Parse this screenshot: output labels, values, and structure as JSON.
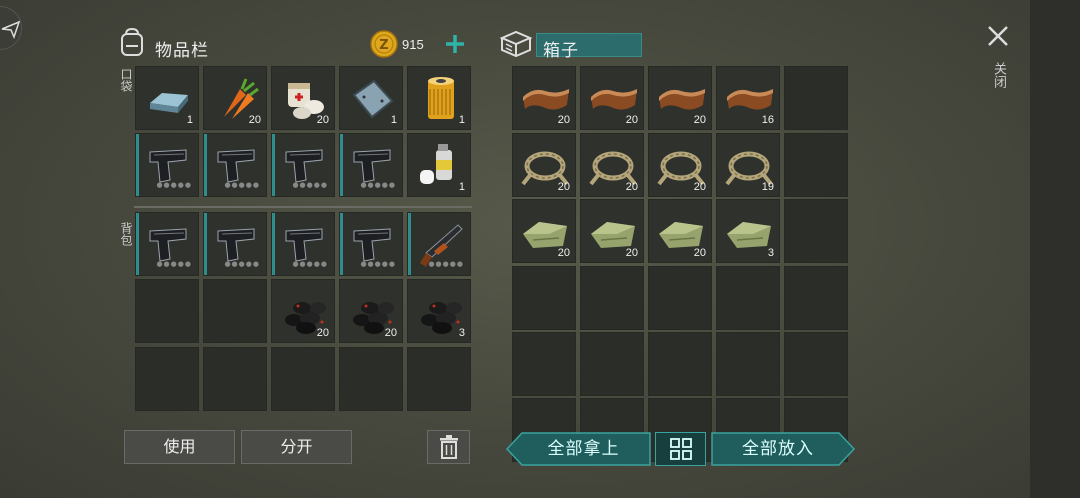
{
  "inventory": {
    "title": "物品栏",
    "coins": "915",
    "pocket_label": "口袋",
    "backpack_label": "背包",
    "pocket_items": [
      {
        "icon": "metal-bar-icon",
        "qty": "1"
      },
      {
        "icon": "carrot-icon",
        "qty": "20"
      },
      {
        "icon": "bandage-icon",
        "qty": "20"
      },
      {
        "icon": "metal-plate-icon",
        "qty": "1"
      },
      {
        "icon": "oil-filter-icon",
        "qty": "1"
      },
      {
        "icon": "pistol-icon",
        "qty": ""
      },
      {
        "icon": "pistol-icon",
        "qty": ""
      },
      {
        "icon": "pistol-icon",
        "qty": ""
      },
      {
        "icon": "pistol-icon",
        "qty": ""
      },
      {
        "icon": "spray-paint-icon",
        "qty": "1"
      }
    ],
    "backpack_items": [
      {
        "icon": "pistol-icon",
        "qty": ""
      },
      {
        "icon": "pistol-icon",
        "qty": ""
      },
      {
        "icon": "pistol-icon",
        "qty": ""
      },
      {
        "icon": "pistol-icon",
        "qty": ""
      },
      {
        "icon": "shotgun-icon",
        "qty": ""
      },
      {
        "icon": "",
        "qty": ""
      },
      {
        "icon": "",
        "qty": ""
      },
      {
        "icon": "coal-icon",
        "qty": "20"
      },
      {
        "icon": "coal-icon",
        "qty": "20"
      },
      {
        "icon": "coal-icon",
        "qty": "3"
      }
    ],
    "use_label": "使用",
    "split_label": "分开"
  },
  "box": {
    "title": "箱子",
    "items": [
      {
        "icon": "leather-icon",
        "qty": "20"
      },
      {
        "icon": "leather-icon",
        "qty": "20"
      },
      {
        "icon": "leather-icon",
        "qty": "20"
      },
      {
        "icon": "leather-icon",
        "qty": "16"
      },
      {
        "icon": "rope-icon",
        "qty": "20"
      },
      {
        "icon": "rope-icon",
        "qty": "20"
      },
      {
        "icon": "rope-icon",
        "qty": "20"
      },
      {
        "icon": "rope-icon",
        "qty": "19"
      },
      {
        "icon": "cloth-icon",
        "qty": "20"
      },
      {
        "icon": "cloth-icon",
        "qty": "20"
      },
      {
        "icon": "cloth-icon",
        "qty": "20"
      },
      {
        "icon": "cloth-icon",
        "qty": "3"
      }
    ],
    "take_all_label": "全部拿上",
    "put_all_label": "全部放入"
  },
  "close_label": "关闭",
  "colors": {
    "accent": "#2f8d8d",
    "teal_button": "#1f5e5c",
    "coin": "#e0a81c"
  }
}
